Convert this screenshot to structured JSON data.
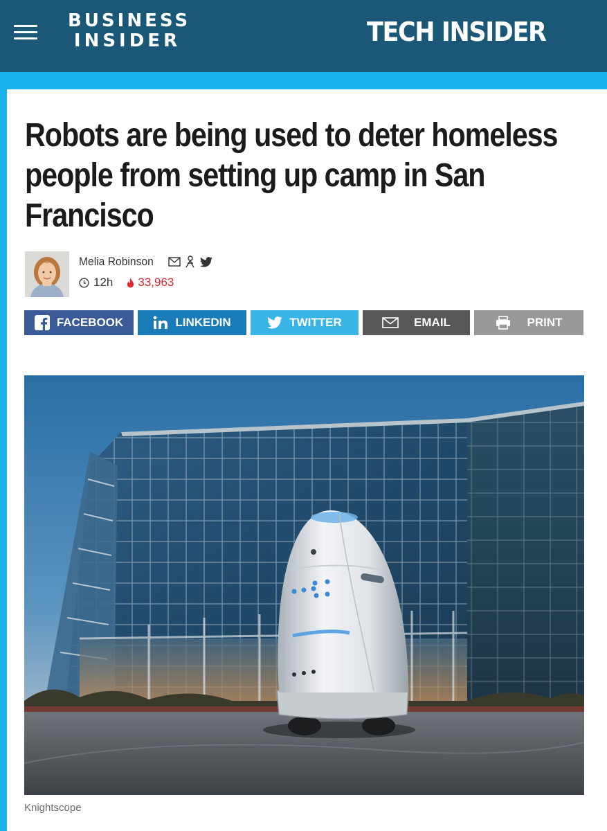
{
  "header": {
    "menu_icon": "hamburger-icon",
    "logo_line1": "BUSINESS",
    "logo_line2": "INSIDER",
    "section": "TECH INSIDER",
    "bar_color": "#1b5878",
    "frame_color": "#1ab2ec"
  },
  "article": {
    "headline": "Robots are being used to deter homeless people from setting up camp in San Francisco",
    "author": "Melia Robinson",
    "author_icons": [
      "email-icon",
      "person-icon",
      "twitter-icon"
    ],
    "time": "12h",
    "time_icon": "clock-icon",
    "views": "33,963",
    "views_icon": "flame-icon",
    "views_color": "#e3262f"
  },
  "share": {
    "facebook": "FACEBOOK",
    "linkedin": "LINKEDIN",
    "twitter": "TWITTER",
    "email": "EMAIL",
    "print": "PRINT",
    "colors": {
      "facebook": "#3a5a98",
      "linkedin": "#1a7bb9",
      "twitter": "#38b5e6",
      "email": "#585858",
      "print": "#999999"
    }
  },
  "image": {
    "caption": "Knightscope"
  }
}
